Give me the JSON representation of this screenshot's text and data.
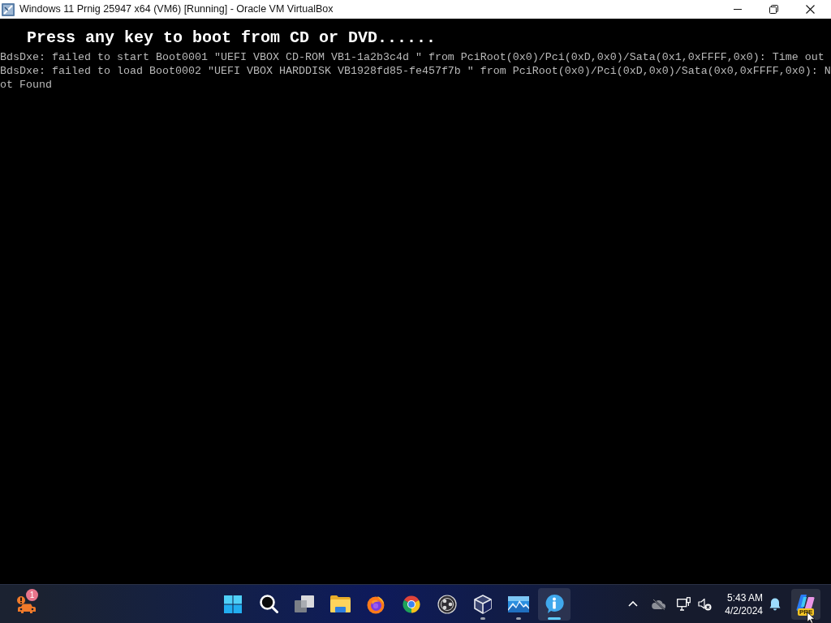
{
  "window": {
    "title": "Windows 11 Prnig 25947 x64 (VM6) [Running] - Oracle VM VirtualBox"
  },
  "vm_screen": {
    "lines": [
      {
        "kind": "prompt",
        "text": "Press any key to boot from CD or DVD......"
      },
      {
        "kind": "log",
        "text": "BdsDxe: failed to start Boot0001 \"UEFI VBOX CD-ROM VB1-1a2b3c4d \" from PciRoot(0x0)/Pci(0xD,0x0)/Sata(0x1,0xFFFF,0x0): Time out"
      },
      {
        "kind": "log",
        "text": "BdsDxe: failed to load Boot0002 \"UEFI VBOX HARDDISK VB1928fd85-fe457f7b \" from PciRoot(0x0)/Pci(0xD,0x0)/Sata(0x0,0xFFFF,0x0): Not Found"
      }
    ]
  },
  "taskbar": {
    "widget": {
      "badge": "1"
    },
    "apps": [
      {
        "kind": "start",
        "running": false,
        "selected": false
      },
      {
        "kind": "search",
        "running": false,
        "selected": false
      },
      {
        "kind": "task_view",
        "running": false,
        "selected": false
      },
      {
        "kind": "folder",
        "running": false,
        "selected": false
      },
      {
        "kind": "firefox",
        "running": false,
        "selected": false
      },
      {
        "kind": "chrome",
        "running": false,
        "selected": false
      },
      {
        "kind": "obs",
        "running": false,
        "selected": false
      },
      {
        "kind": "cube",
        "running": true,
        "selected": false
      },
      {
        "kind": "picture",
        "running": true,
        "selected": false
      },
      {
        "kind": "info",
        "running": true,
        "selected": true
      }
    ],
    "tray": {
      "time": "5:43 AM",
      "date": "4/2/2024",
      "assistant": {
        "badge": "PRE",
        "hovered": true
      }
    }
  }
}
